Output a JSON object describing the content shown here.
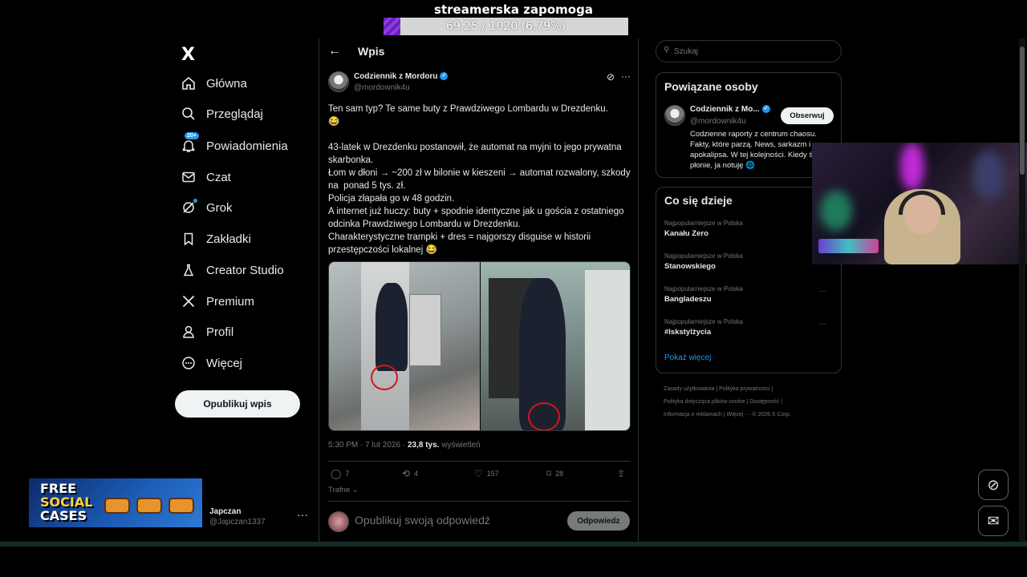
{
  "overlay": {
    "title": "streamerska zapomoga",
    "progress_text": "69.25 / 1020 (6.79%)",
    "progress_fraction": 0.0679,
    "promo": {
      "line1": "FREE",
      "line2": "SOCIAL",
      "line3": "CASES"
    }
  },
  "nav": {
    "logo": "X",
    "items": [
      {
        "label": "Główna",
        "icon": "home-icon"
      },
      {
        "label": "Przeglądaj",
        "icon": "search-icon"
      },
      {
        "label": "Powiadomienia",
        "icon": "bell-icon",
        "badge": "20+"
      },
      {
        "label": "Czat",
        "icon": "mail-icon"
      },
      {
        "label": "Grok",
        "icon": "grok-icon"
      },
      {
        "label": "Zakładki",
        "icon": "bookmark-icon"
      },
      {
        "label": "Creator Studio",
        "icon": "flask-icon"
      },
      {
        "label": "Premium",
        "icon": "x-icon"
      },
      {
        "label": "Profil",
        "icon": "person-icon"
      },
      {
        "label": "Więcej",
        "icon": "more-circle-icon"
      }
    ],
    "post_button": "Opublikuj wpis",
    "account": {
      "name": "Japczan",
      "handle": "@Japczan1337",
      "more": "···"
    }
  },
  "main": {
    "header_title": "Wpis",
    "author": {
      "name": "Codziennik z Mordoru",
      "handle": "@mordownik4u"
    },
    "tweet_text": "Ten sam typ? Te same buty z Prawdziwego Lombardu w Drezdenku.\n😂\n\n43-latek w Drezdenku postanowił, że automat na myjni to jego prywatna skarbonka.\nŁom w dłoni → ~200 zł w bilonie w kieszeni → automat rozwalony, szkody na  ponad 5 tys. zł.\nPolicja złapała go w 48 godzin.\nA internet już huczy: buty + spodnie identyczne jak u gościa z ostatniego odcinka Prawdziwego Lombardu w Drezdenku.\nCharakterystyczne trampki + dres = najgorszy disguise w historii przestępczości lokalnej 😂",
    "meta_time": "5:30 PM · 7 lut 2026 · ",
    "meta_views": "23,8 tys.",
    "meta_views_label": " wyświetleń",
    "actions": {
      "replies": "7",
      "reposts": "4",
      "likes": "157",
      "bookmarks": "28"
    },
    "sort_label": "Trafne",
    "reply_placeholder": "Opublikuj swoją odpowiedź",
    "reply_button": "Odpowiedz"
  },
  "sidebar": {
    "search_placeholder": "Szukaj",
    "related": {
      "title": "Powiązane osoby",
      "name": "Codziennik z Mo...",
      "handle": "@mordownik4u",
      "follow_button": "Obserwuj",
      "bio": "Codzienne raporty z centrum chaosu. Fakty, które parzą. News, sarkazm i apokalipsa. W tej kolejności. Kiedy świat płonie, ja notuję 🌐"
    },
    "trends": {
      "title": "Co się dzieje",
      "items": [
        {
          "category": "Najpopularniejsze w Polska",
          "name": "Kanału Zero"
        },
        {
          "category": "Najpopularniejsze w Polska",
          "name": "Stanowskiego"
        },
        {
          "category": "Najpopularniejsze w Polska",
          "name": "Bangladeszu"
        },
        {
          "category": "Najpopularniejsze w Polska",
          "name": "#lskstylżycia"
        }
      ],
      "show_more": "Pokaż więcej"
    },
    "footer": {
      "line1": "Zasady użytkowania  |  Polityka prywatności  |",
      "line2": "Polityka dotycząca plików cookie  |  Dostępność  |",
      "line3": "Informacja o reklamach  |  Więcej ···  © 2026 X Corp."
    }
  },
  "colors": {
    "accent": "#1d9bf0",
    "background": "#000000",
    "border": "#2f3336",
    "muted": "#71767b",
    "progress": "#7b2fd0"
  }
}
